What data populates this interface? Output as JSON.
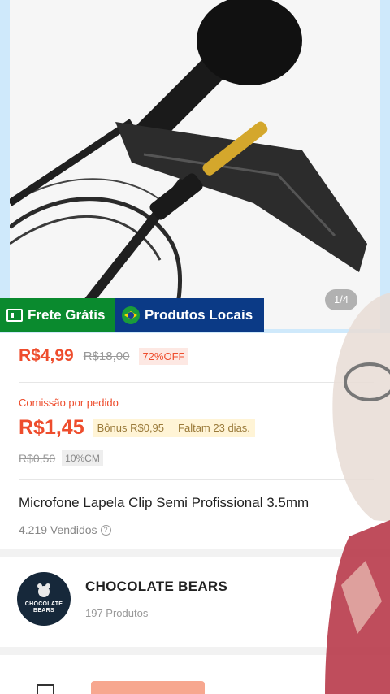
{
  "gallery": {
    "page_indicator": "1/4"
  },
  "badges": {
    "frete": "Frete Grátis",
    "locais": "Produtos Locais"
  },
  "price": {
    "current": "R$4,99",
    "original": "R$18,00",
    "discount": "72%OFF"
  },
  "commission": {
    "label": "Comissão por pedido",
    "value": "R$1,45",
    "bonus": "Bônus R$0,95",
    "remaining": "Faltam 23 dias.",
    "old_value": "R$0,50",
    "cm_percent": "10%CM"
  },
  "product": {
    "title": "Microfone Lapela Clip Semi Profissional 3.5mm",
    "sold": "4.219 Vendidos"
  },
  "shop": {
    "name": "CHOCOLATE BEARS",
    "products": "197 Produtos",
    "avatar_text_1": "CHOCOLATE",
    "avatar_text_2": "BEARS"
  },
  "colors": {
    "accent": "#ee4d2d",
    "frete_green": "#0a8a2e",
    "locais_blue": "#0b3a86"
  },
  "icons": [
    "truck-icon",
    "brazil-flag-icon",
    "info-icon",
    "store-icon"
  ]
}
